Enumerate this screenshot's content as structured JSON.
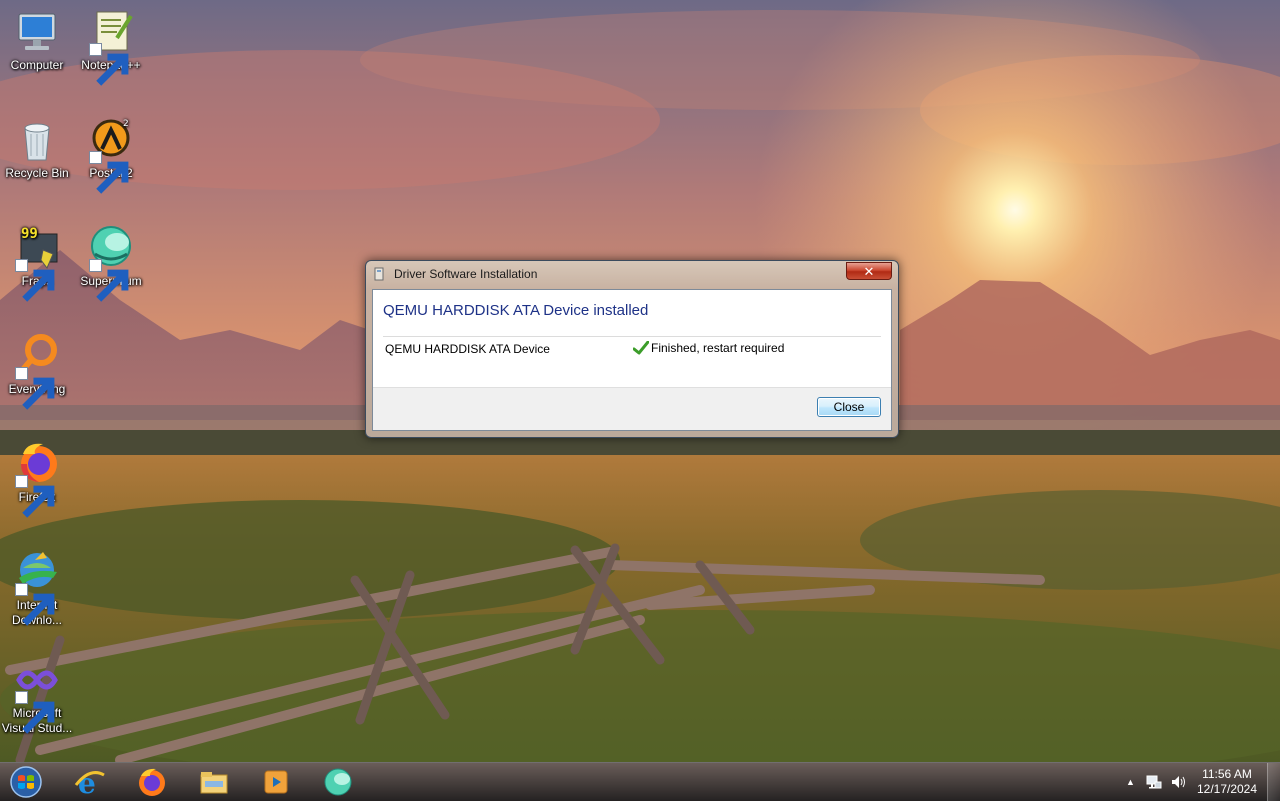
{
  "desktop": {
    "icons": [
      {
        "label": "Computer"
      },
      {
        "label": "Notepad++"
      },
      {
        "label": "Recycle Bin"
      },
      {
        "label": "Postal 2"
      },
      {
        "label": "Fraps"
      },
      {
        "label": "Supermium"
      },
      {
        "label": "Everything"
      },
      {
        "label": "Firefox"
      },
      {
        "label": "Internet Downlo..."
      },
      {
        "label": "Microsoft Visual Stud..."
      }
    ]
  },
  "dialog": {
    "title": "Driver Software Installation",
    "close_glyph": "✕",
    "heading": "QEMU HARDDISK ATA Device installed",
    "device_name": "QEMU HARDDISK ATA Device",
    "status": "Finished, restart required",
    "status_icon": "green-checkmark-icon",
    "close_button": "Close"
  },
  "taskbar": {
    "pinned": [
      {
        "icon": "internet-explorer-icon"
      },
      {
        "icon": "firefox-icon"
      },
      {
        "icon": "file-explorer-icon"
      },
      {
        "icon": "media-player-icon"
      },
      {
        "icon": "supermium-icon"
      }
    ],
    "tray": {
      "show_hidden": "▲",
      "time": "11:56 AM",
      "date": "12/17/2024"
    }
  },
  "colors": {
    "heading": "#1e3287",
    "close_red": "#c94e35",
    "button_blue": "#3c7fb1"
  }
}
